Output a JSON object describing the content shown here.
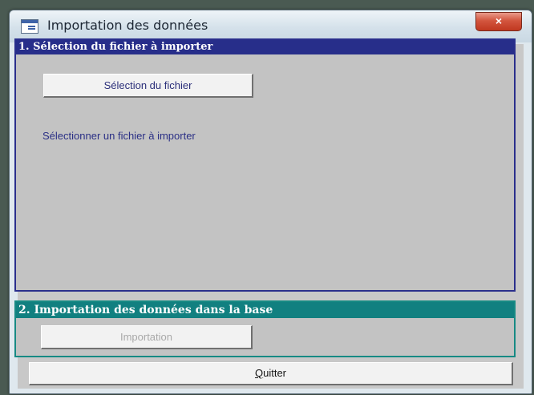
{
  "window": {
    "title": "Importation des données",
    "close_symbol": "×"
  },
  "section1": {
    "header": "1. Sélection du fichier à importer",
    "select_button_label": "Sélection du fichier",
    "status_text": "Sélectionner un fichier à importer"
  },
  "section2": {
    "header": "2. Importation des données dans la base",
    "import_button_label": "Importation"
  },
  "footer": {
    "quit_mnemonic": "Q",
    "quit_rest": "uitter"
  },
  "icons": {
    "window_icon": "form-window-icon",
    "close_icon": "close-icon"
  },
  "colors": {
    "section1_header": "#272e8a",
    "section2_header": "#118080",
    "close_button": "#c03820"
  }
}
